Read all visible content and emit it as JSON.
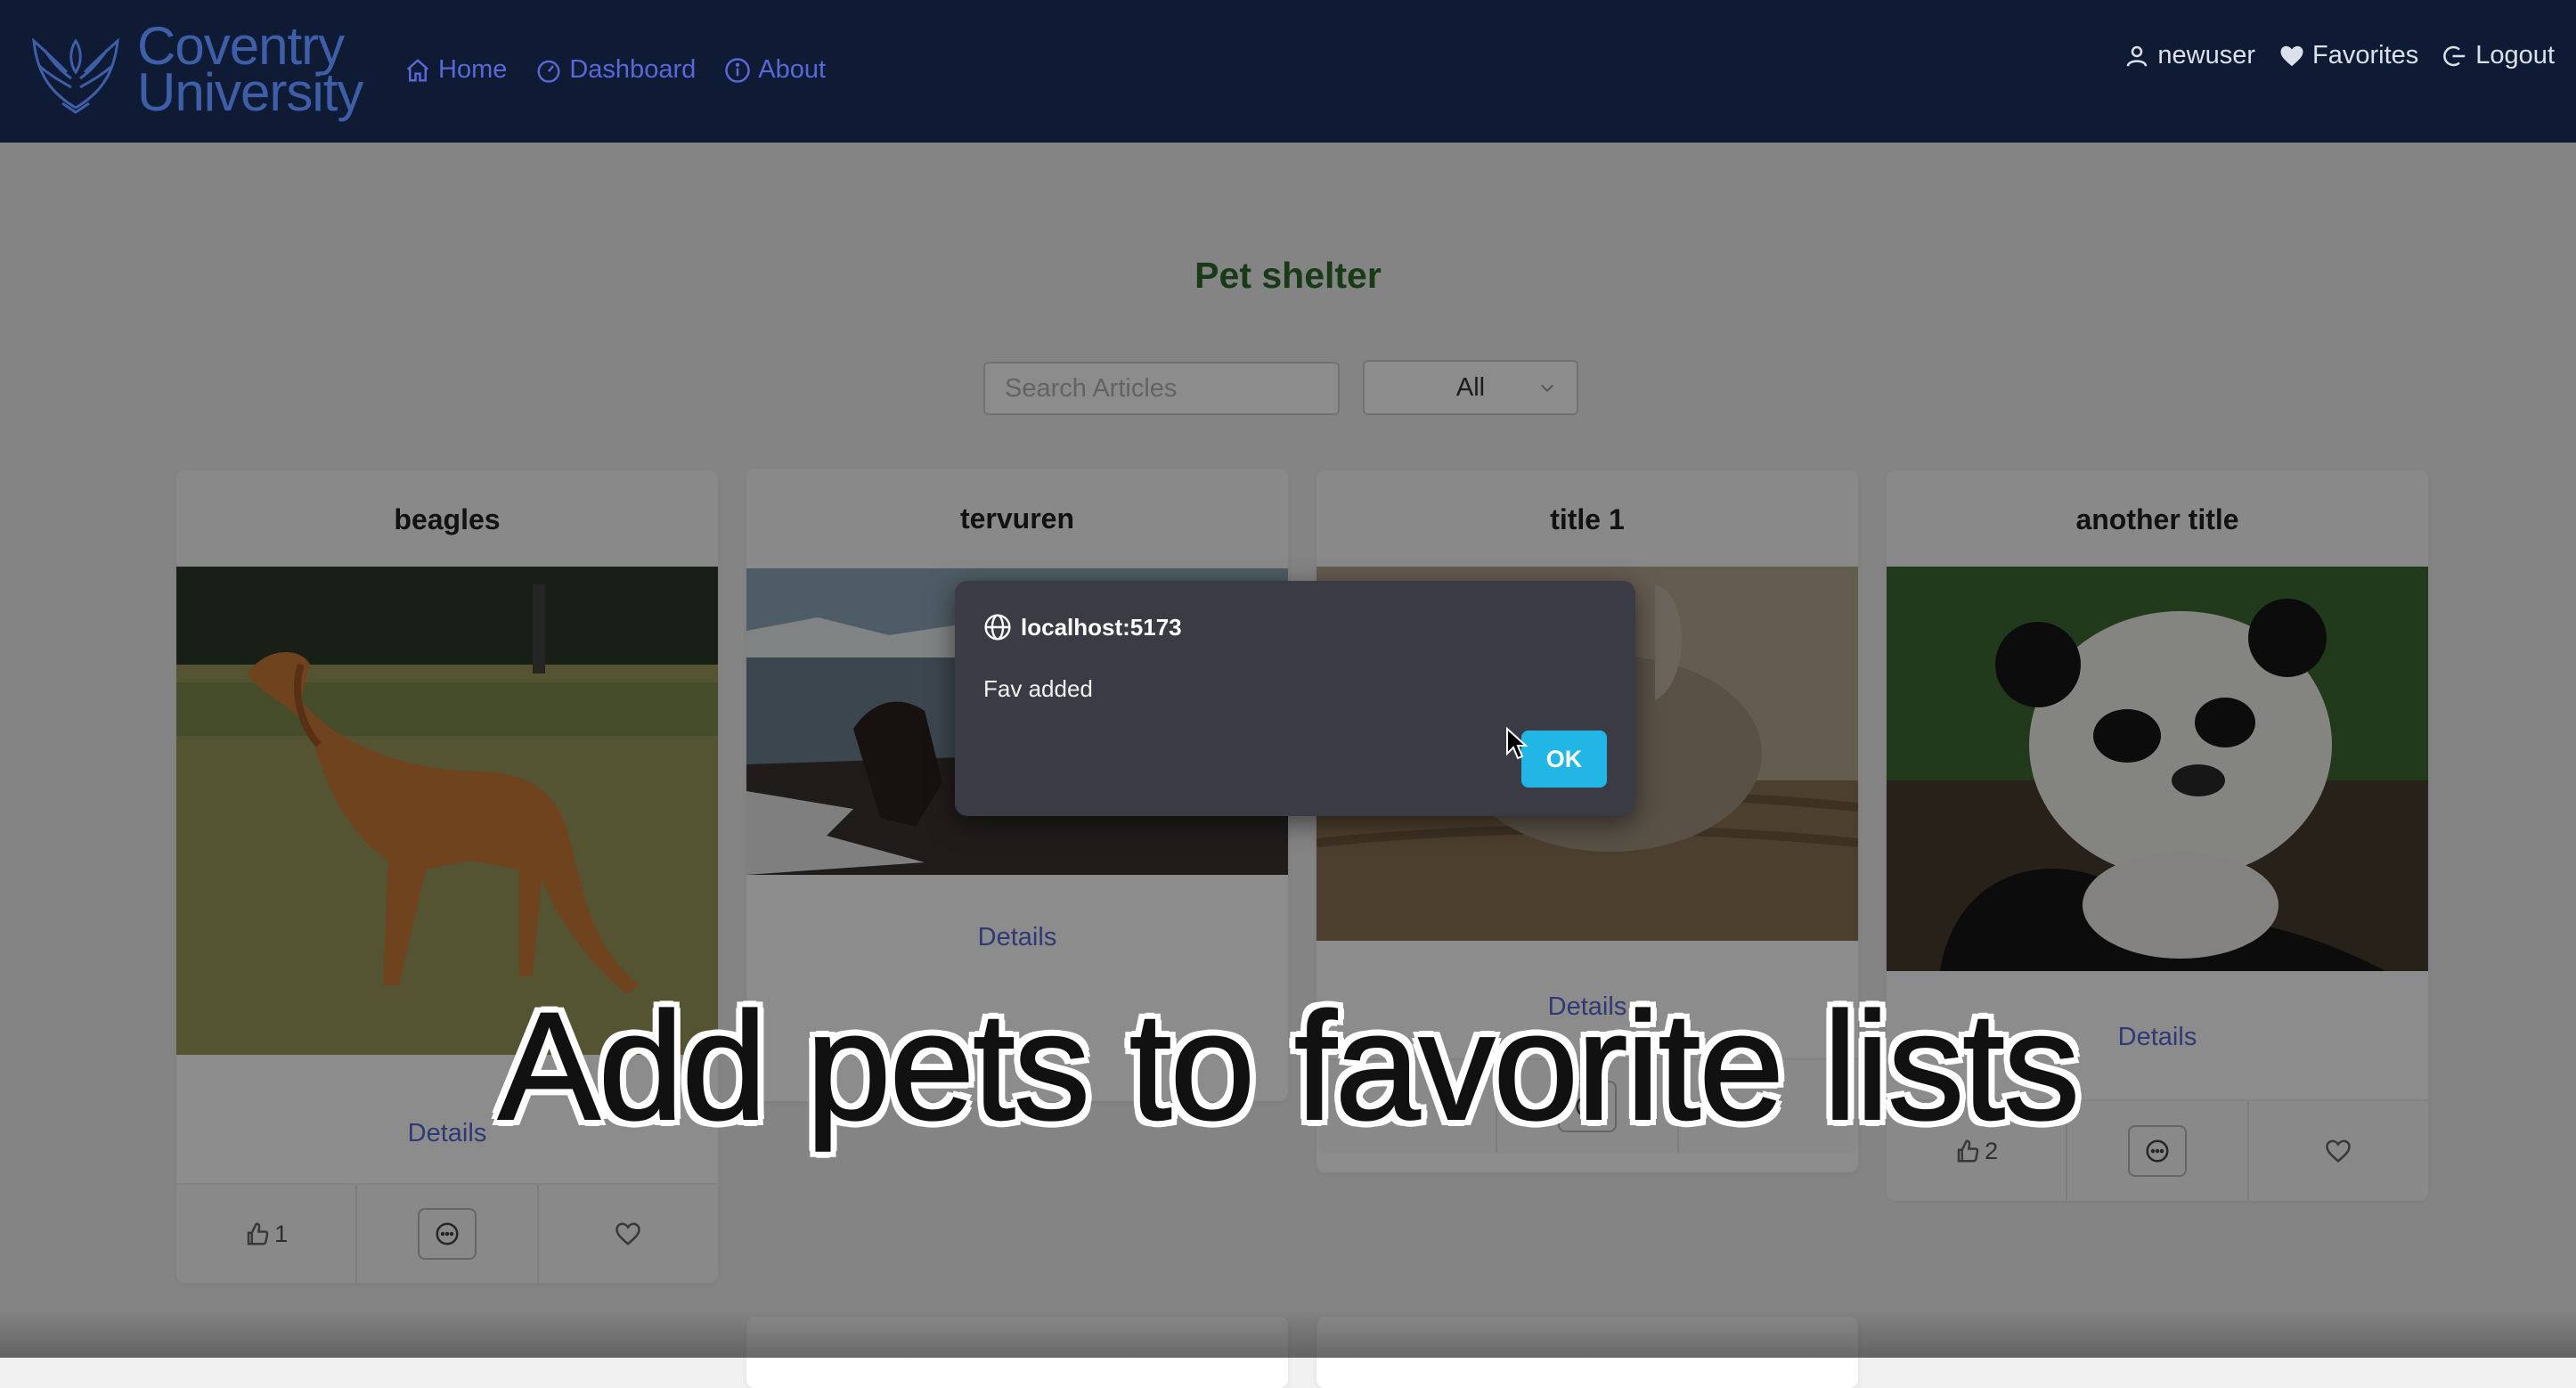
{
  "app": {
    "logo_line1": "Coventry",
    "logo_line2": "University",
    "logo_icon": "phoenix-crest-icon"
  },
  "nav": {
    "left": [
      {
        "label": "Home",
        "icon": "home-icon"
      },
      {
        "label": "Dashboard",
        "icon": "dashboard-icon"
      },
      {
        "label": "About",
        "icon": "info-icon"
      }
    ],
    "right": [
      {
        "label": "newuser",
        "icon": "user-icon"
      },
      {
        "label": "Favorites",
        "icon": "heart-icon"
      },
      {
        "label": "Logout",
        "icon": "logout-icon"
      }
    ]
  },
  "main": {
    "title": "Pet shelter",
    "search_placeholder": "Search Articles",
    "filter_value": "All"
  },
  "cards": [
    {
      "title": "beagles",
      "details": "Details",
      "likes": "1",
      "image": "saluki-dog-on-grass"
    },
    {
      "title": "tervuren",
      "details": "Details",
      "image": "dog-by-snowy-lake"
    },
    {
      "title": "title 1",
      "details": "Details",
      "image": "rabbit-on-woven-mat"
    },
    {
      "title": "another title",
      "details": "Details",
      "likes": "2",
      "image": "giant-panda-eating"
    }
  ],
  "dialog": {
    "origin": "localhost:5173",
    "message": "Fav added",
    "ok_label": "OK"
  },
  "caption": "Add pets to favorite lists",
  "colors": {
    "navbar": "#0f1b35",
    "link": "#5a68d6",
    "title": "#2e6a2a",
    "ok_button": "#22b6e6",
    "dialog": "#3b3b45"
  }
}
